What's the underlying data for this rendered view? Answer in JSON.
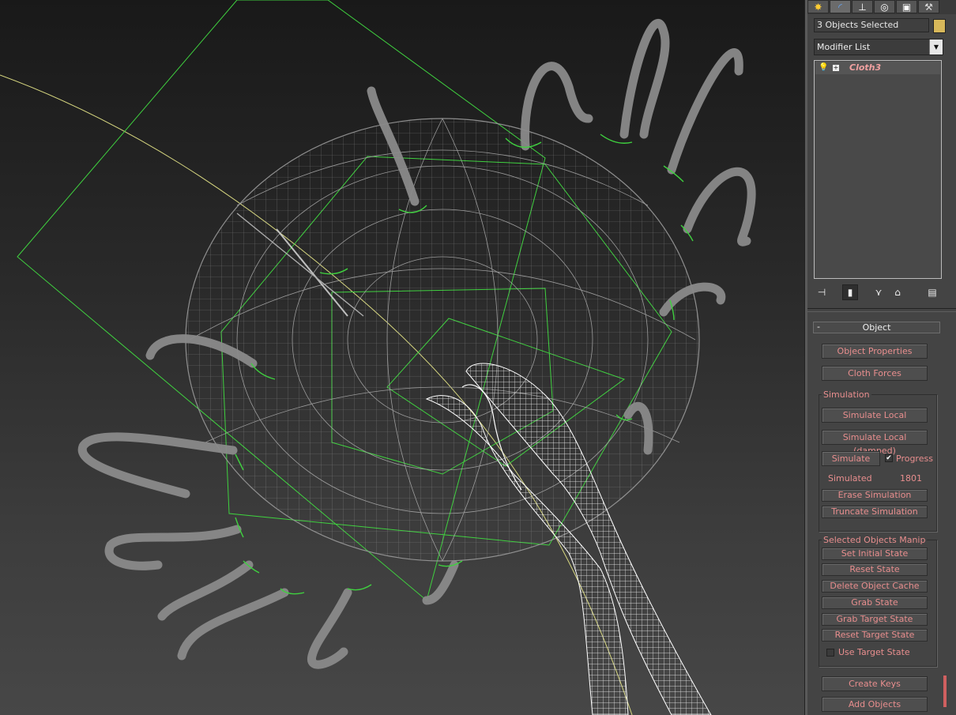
{
  "command_panel": {
    "tabs": [
      {
        "name": "create-tab",
        "glyph": "✸"
      },
      {
        "name": "modify-tab",
        "glyph": "◜"
      },
      {
        "name": "hierarchy-tab",
        "glyph": "⊥"
      },
      {
        "name": "motion-tab",
        "glyph": "◎"
      },
      {
        "name": "display-tab",
        "glyph": "▣"
      },
      {
        "name": "utilities-tab",
        "glyph": "⚒"
      }
    ],
    "selection_name": "3 Objects Selected",
    "selection_color": "#d8b85a",
    "modifier_list_label": "Modifier List",
    "stack": [
      {
        "name": "Cloth3"
      }
    ],
    "stack_tools": [
      "pin-stack-icon",
      "show-end-result-icon",
      "make-unique-icon",
      "remove-modifier-icon",
      "configure-sets-icon"
    ]
  },
  "rollout": {
    "title": "Object",
    "object_properties": "Object Properties",
    "cloth_forces": "Cloth Forces",
    "simulation": {
      "label": "Simulation",
      "simulate_local": "Simulate Local",
      "simulate_local_damped": "Simulate Local (damped)",
      "simulate": "Simulate",
      "progress_label": "Progress",
      "progress_checked": true,
      "simulated_label": "Simulated",
      "simulated_value": "1801",
      "erase": "Erase Simulation",
      "truncate": "Truncate Simulation"
    },
    "manip": {
      "label": "Selected Objects Manip",
      "set_initial": "Set Initial State",
      "reset_state": "Reset State",
      "delete_cache": "Delete Object Cache",
      "grab_state": "Grab State",
      "grab_target": "Grab Target State",
      "reset_target": "Reset Target State",
      "use_target_label": "Use Target State",
      "use_target_checked": false
    },
    "create_keys": "Create Keys",
    "add_objects": "Add Objects"
  },
  "colors": {
    "accent_text": "#e88e8e",
    "wire_green": "#3fd13f",
    "wire_gray": "#8a8a8a",
    "wire_white": "#ffffff"
  }
}
